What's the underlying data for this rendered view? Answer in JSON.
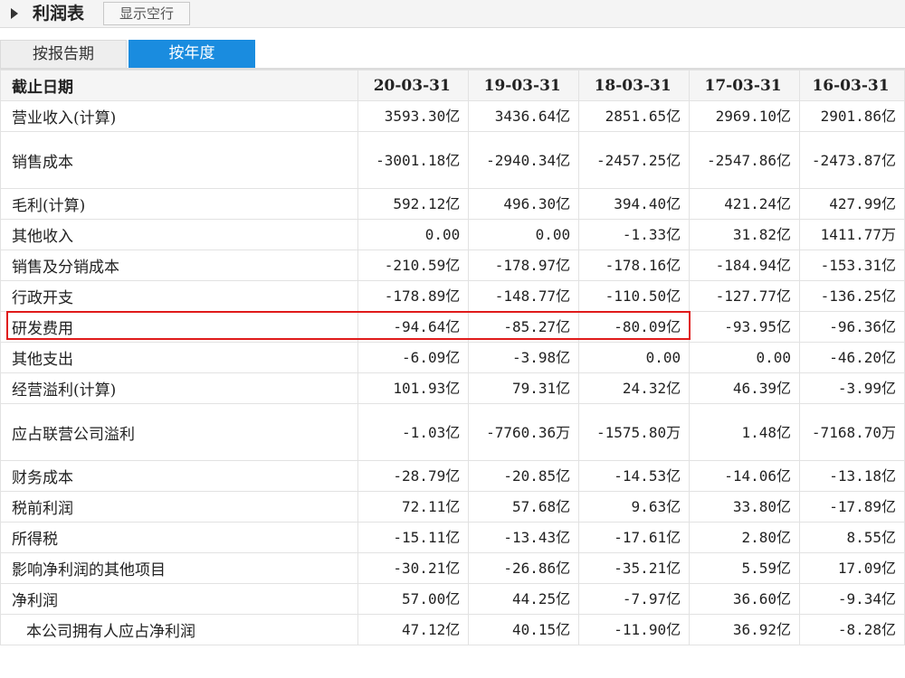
{
  "header": {
    "title": "利润表",
    "show_empty_label": "显示空行"
  },
  "tabs": [
    {
      "label": "按报告期",
      "active": false
    },
    {
      "label": "按年度",
      "active": true
    }
  ],
  "table": {
    "corner": "截止日期",
    "columns": [
      "20-03-31",
      "19-03-31",
      "18-03-31",
      "17-03-31",
      "16-03-31"
    ],
    "rows": [
      {
        "label": "营业收入(计算)",
        "values": [
          "3593.30亿",
          "3436.64亿",
          "2851.65亿",
          "2969.10亿",
          "2901.86亿"
        ]
      },
      {
        "label": "销售成本",
        "values": [
          "-3001.18亿",
          "-2940.34亿",
          "-2457.25亿",
          "-2547.86亿",
          "-2473.87亿"
        ]
      },
      {
        "label": "毛利(计算)",
        "values": [
          "592.12亿",
          "496.30亿",
          "394.40亿",
          "421.24亿",
          "427.99亿"
        ]
      },
      {
        "label": "其他收入",
        "values": [
          "0.00",
          "0.00",
          "-1.33亿",
          "31.82亿",
          "1411.77万"
        ]
      },
      {
        "label": "销售及分销成本",
        "values": [
          "-210.59亿",
          "-178.97亿",
          "-178.16亿",
          "-184.94亿",
          "-153.31亿"
        ]
      },
      {
        "label": "行政开支",
        "values": [
          "-178.89亿",
          "-148.77亿",
          "-110.50亿",
          "-127.77亿",
          "-136.25亿"
        ]
      },
      {
        "label": "研发费用",
        "values": [
          "-94.64亿",
          "-85.27亿",
          "-80.09亿",
          "-93.95亿",
          "-96.36亿"
        ]
      },
      {
        "label": "其他支出",
        "values": [
          "-6.09亿",
          "-3.98亿",
          "0.00",
          "0.00",
          "-46.20亿"
        ]
      },
      {
        "label": "经营溢利(计算)",
        "values": [
          "101.93亿",
          "79.31亿",
          "24.32亿",
          "46.39亿",
          "-3.99亿"
        ]
      },
      {
        "label": "应占联营公司溢利",
        "values": [
          "-1.03亿",
          "-7760.36万",
          "-1575.80万",
          "1.48亿",
          "-7168.70万"
        ]
      },
      {
        "label": "财务成本",
        "values": [
          "-28.79亿",
          "-20.85亿",
          "-14.53亿",
          "-14.06亿",
          "-13.18亿"
        ]
      },
      {
        "label": "税前利润",
        "values": [
          "72.11亿",
          "57.68亿",
          "9.63亿",
          "33.80亿",
          "-17.89亿"
        ]
      },
      {
        "label": "所得税",
        "values": [
          "-15.11亿",
          "-13.43亿",
          "-17.61亿",
          "2.80亿",
          "8.55亿"
        ]
      },
      {
        "label": "影响净利润的其他项目",
        "values": [
          "-30.21亿",
          "-26.86亿",
          "-35.21亿",
          "5.59亿",
          "17.09亿"
        ]
      },
      {
        "label": "净利润",
        "values": [
          "57.00亿",
          "44.25亿",
          "-7.97亿",
          "36.60亿",
          "-9.34亿"
        ]
      },
      {
        "label": "本公司拥有人应占净利润",
        "values": [
          "47.12亿",
          "40.15亿",
          "-11.90亿",
          "36.92亿",
          "-8.28亿"
        ]
      }
    ]
  },
  "colors": {
    "active_tab": "#1a8cdf",
    "highlight_border": "#e01b1b"
  }
}
